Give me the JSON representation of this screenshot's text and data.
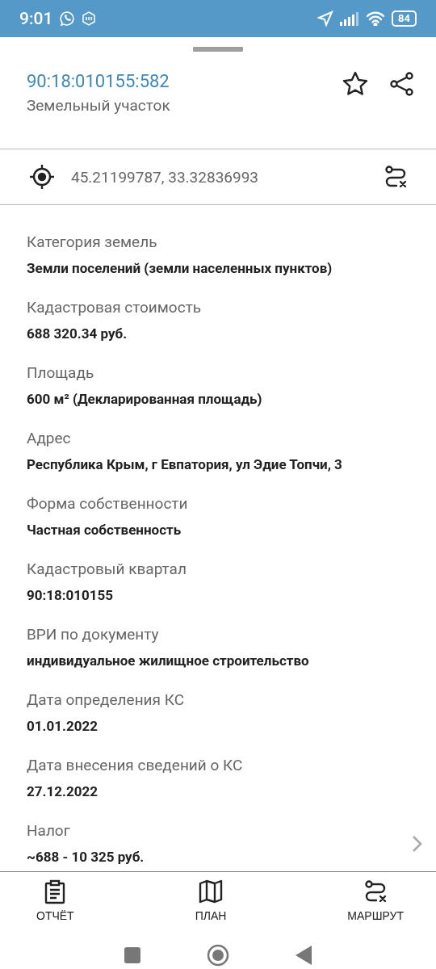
{
  "status_bar": {
    "time": "9:01",
    "battery": "84"
  },
  "header": {
    "title": "90:18:010155:582",
    "subtitle": "Земельный участок",
    "favorite": false
  },
  "coordinates": {
    "value": "45.21199787, 33.32836993"
  },
  "fields": [
    {
      "label": "Категория земель",
      "value": "Земли поселений (земли населенных пунктов)",
      "kind": "text"
    },
    {
      "label": "Кадастровая стоимость",
      "value": "688 320.34 руб.",
      "kind": "text"
    },
    {
      "label": "Площадь",
      "value": "600 м² (Декларированная площадь)",
      "kind": "text"
    },
    {
      "label": "Адрес",
      "value": "Республика Крым, г Евпатория, ул Эдие Топчи, 3",
      "kind": "text"
    },
    {
      "label": "Форма собственности",
      "value": "Частная собственность",
      "kind": "text"
    },
    {
      "label": "Кадастровый квартал",
      "value": "90:18:010155",
      "kind": "text"
    },
    {
      "label": "ВРИ по документу",
      "value": "индивидуальное жилищное строительство",
      "kind": "text"
    },
    {
      "label": "Дата определения КС",
      "value": "01.01.2022",
      "kind": "text"
    },
    {
      "label": "Дата внесения сведений о КС",
      "value": "27.12.2022",
      "kind": "text"
    },
    {
      "label": "Налог",
      "value": "~688 - 10 325 руб.",
      "kind": "link"
    }
  ],
  "bottom_nav": [
    {
      "label": "ОТЧЁТ",
      "kind": "report"
    },
    {
      "label": "ПЛАН",
      "kind": "plan"
    },
    {
      "label": "МАРШРУТ",
      "kind": "route"
    }
  ]
}
